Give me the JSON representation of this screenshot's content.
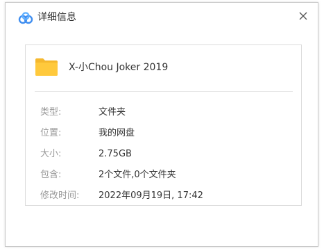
{
  "dialog": {
    "title": "详细信息",
    "close_symbol": "✕"
  },
  "file": {
    "name": "X-小Chou Joker 2019",
    "icon": "folder-icon"
  },
  "details": [
    {
      "label": "类型:",
      "value": "文件夹"
    },
    {
      "label": "位置:",
      "value": "我的网盘"
    },
    {
      "label": "大小:",
      "value": "2.75GB"
    },
    {
      "label": "包含:",
      "value": "2个文件,0个文件夹"
    },
    {
      "label": "修改时间:",
      "value": "2022年09月19日, 17:42"
    }
  ],
  "colors": {
    "app_icon_blue": "#3f8ef0",
    "folder_yellow": "#ffc93c",
    "label_gray": "#999999",
    "text_dark": "#333333"
  }
}
